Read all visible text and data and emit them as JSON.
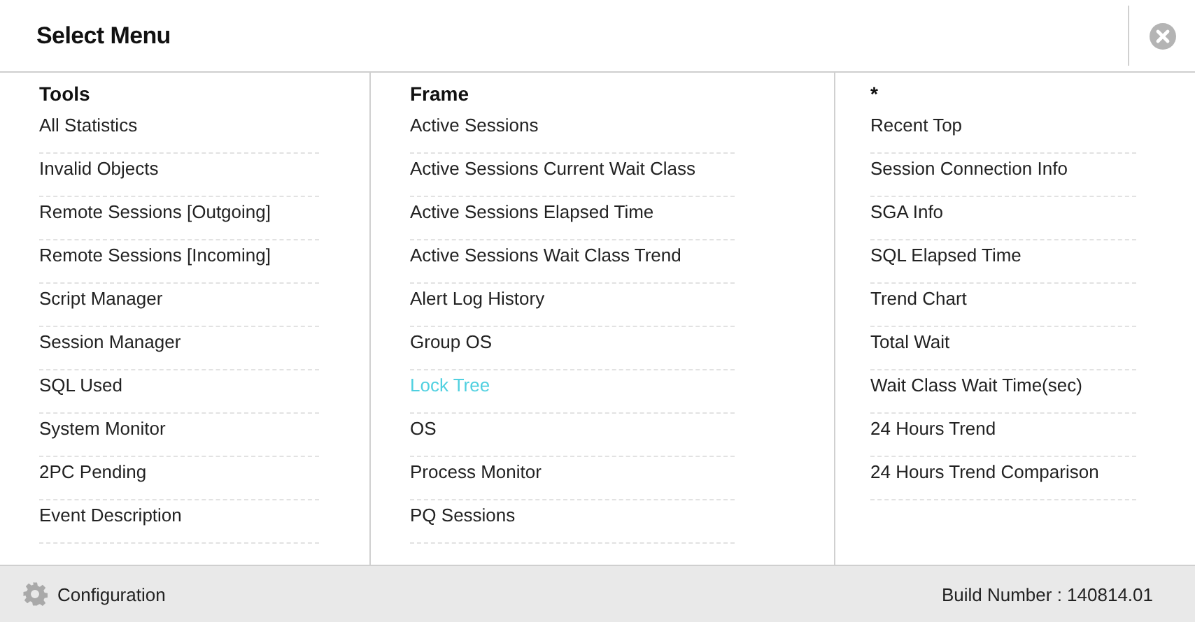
{
  "dialog": {
    "title": "Select Menu"
  },
  "columns": [
    {
      "heading": "Tools",
      "items": [
        {
          "label": "All Statistics",
          "selected": false
        },
        {
          "label": "Invalid Objects",
          "selected": false
        },
        {
          "label": "Remote Sessions [Outgoing]",
          "selected": false
        },
        {
          "label": "Remote Sessions [Incoming]",
          "selected": false
        },
        {
          "label": "Script Manager",
          "selected": false
        },
        {
          "label": "Session Manager",
          "selected": false
        },
        {
          "label": "SQL Used",
          "selected": false
        },
        {
          "label": "System Monitor",
          "selected": false
        },
        {
          "label": "2PC Pending",
          "selected": false
        },
        {
          "label": "Event Description",
          "selected": false
        }
      ]
    },
    {
      "heading": "Frame",
      "items": [
        {
          "label": "Active Sessions",
          "selected": false
        },
        {
          "label": "Active Sessions Current Wait Class",
          "selected": false
        },
        {
          "label": "Active Sessions Elapsed Time",
          "selected": false
        },
        {
          "label": "Active Sessions Wait Class Trend",
          "selected": false
        },
        {
          "label": "Alert Log History",
          "selected": false
        },
        {
          "label": "Group OS",
          "selected": false
        },
        {
          "label": "Lock Tree",
          "selected": true
        },
        {
          "label": "OS",
          "selected": false
        },
        {
          "label": "Process Monitor",
          "selected": false
        },
        {
          "label": "PQ Sessions",
          "selected": false
        }
      ]
    },
    {
      "heading": "*",
      "items": [
        {
          "label": "Recent Top",
          "selected": false
        },
        {
          "label": "Session Connection Info",
          "selected": false
        },
        {
          "label": "SGA Info",
          "selected": false
        },
        {
          "label": "SQL Elapsed Time",
          "selected": false
        },
        {
          "label": "Trend Chart",
          "selected": false
        },
        {
          "label": "Total Wait",
          "selected": false
        },
        {
          "label": "Wait Class Wait Time(sec)",
          "selected": false
        },
        {
          "label": "24 Hours Trend",
          "selected": false
        },
        {
          "label": "24 Hours Trend Comparison",
          "selected": false
        }
      ]
    }
  ],
  "footer": {
    "configuration": "Configuration",
    "build": "Build Number : 140814.01"
  }
}
